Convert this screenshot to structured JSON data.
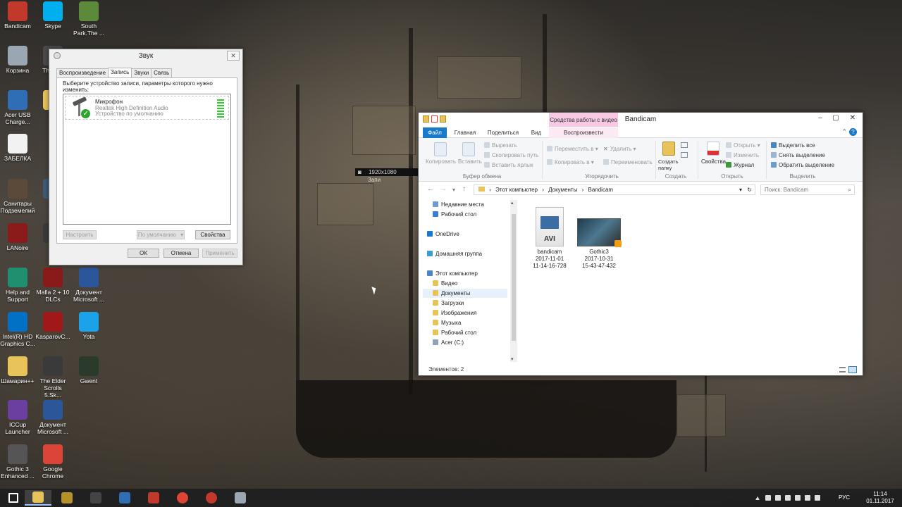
{
  "desktop": {
    "icons": [
      {
        "label": "Bandicam",
        "icon": "bandicam-icon",
        "color": "#c0392b"
      },
      {
        "label": "Skype",
        "icon": "skype-icon",
        "color": "#00aff0"
      },
      {
        "label": "South Park.The ...",
        "icon": "southpark-icon",
        "color": "#5d8a3a"
      },
      {
        "label": "Корзина",
        "icon": "recycle-bin-icon",
        "color": "#9aa7b3"
      },
      {
        "label": "Th Scro",
        "icon": "game-icon",
        "color": "#4a4a4a"
      },
      {
        "label": "Acer USB Charge...",
        "icon": "usb-charge-icon",
        "color": "#2f6db5"
      },
      {
        "label": "DC",
        "icon": "folder-icon",
        "color": "#e8c35a"
      },
      {
        "label": "ЗАБЕЛКА",
        "icon": "document-icon",
        "color": "#f2f2f2"
      },
      {
        "label": "Санитары Подземелий",
        "icon": "game-icon",
        "color": "#5b4a3a"
      },
      {
        "label": "Me",
        "icon": "game-icon",
        "color": "#3e5b78"
      },
      {
        "label": "LANoire",
        "icon": "lanoire-icon",
        "color": "#8b1a1a"
      },
      {
        "label": "S",
        "icon": "game-icon",
        "color": "#3a3a3a"
      },
      {
        "label": "Help and Support",
        "icon": "help-icon",
        "color": "#1f8f6f"
      },
      {
        "label": "Mafia 2 + 10 DLCs",
        "icon": "mafia-icon",
        "color": "#8a1a1a"
      },
      {
        "label": "Документ Microsoft ...",
        "icon": "word-document-icon",
        "color": "#2b579a"
      },
      {
        "label": "Intel(R) HD Graphics C...",
        "icon": "intel-graphics-icon",
        "color": "#0071c5"
      },
      {
        "label": "KasparovC...",
        "icon": "chess-icon",
        "color": "#a01818"
      },
      {
        "label": "Yota",
        "icon": "yota-icon",
        "color": "#1aa3e8"
      },
      {
        "label": "Шамарин++",
        "icon": "document-icon",
        "color": "#e8c35a"
      },
      {
        "label": "The Elder Scrolls 5.Sk...",
        "icon": "skyrim-icon",
        "color": "#3a3a3a"
      },
      {
        "label": "Gwent",
        "icon": "gwent-icon",
        "color": "#2b3b2b"
      },
      {
        "label": "ICCup Launcher",
        "icon": "iccup-icon",
        "color": "#6b3fa0"
      },
      {
        "label": "Документ Microsoft ...",
        "icon": "word-document-icon",
        "color": "#2b579a"
      },
      {
        "label": "Gothic 3 Enhanced ...",
        "icon": "gothic-icon",
        "color": "#555555"
      },
      {
        "label": "Google Chrome",
        "icon": "chrome-icon",
        "color": "#db4437"
      }
    ]
  },
  "sound_dialog": {
    "title": "Звук",
    "tabs": [
      "Воспроизведение",
      "Запись",
      "Звуки",
      "Связь"
    ],
    "active_tab": "Запись",
    "instruction": "Выберите устройство записи, параметры которого нужно изменить:",
    "device": {
      "name": "Микрофон",
      "driver": "Realtek High Definition Audio",
      "status": "Устройство по умолчанию"
    },
    "buttons": {
      "configure": "Настроить",
      "default": "По умолчанию",
      "properties": "Свойства",
      "ok": "ОК",
      "cancel": "Отмена",
      "apply": "Применить"
    }
  },
  "overlay": {
    "resolution": "1920x1080",
    "rec_text": "Запи"
  },
  "explorer": {
    "title": "Bandicam",
    "context_tab": "Средства работы с видео",
    "tabs": [
      "Файл",
      "Главная",
      "Поделиться",
      "Вид",
      "Воспроизвести"
    ],
    "ribbon": {
      "clipboard": {
        "label": "Буфер обмена",
        "copy": "Копировать",
        "paste": "Вставить",
        "cut": "Вырезать",
        "copy_path": "Скопировать путь",
        "paste_shortcut": "Вставить ярлык"
      },
      "organize": {
        "label": "Упорядочить",
        "move_to": "Переместить в",
        "copy_to": "Копировать в",
        "delete": "Удалить",
        "rename": "Переименовать"
      },
      "new": {
        "label": "Создать",
        "new_folder": "Создать папку"
      },
      "open": {
        "label": "Открыть",
        "properties": "Свойства",
        "open": "Открыть",
        "edit": "Изменить",
        "history": "Журнал"
      },
      "select": {
        "label": "Выделить",
        "select_all": "Выделить все",
        "select_none": "Снять выделение",
        "invert": "Обратить выделение"
      }
    },
    "breadcrumb": [
      "Этот компьютер",
      "Документы",
      "Bandicam"
    ],
    "search_placeholder": "Поиск: Bandicam",
    "nav": [
      {
        "label": "Недавние места",
        "icon": "recent-places-icon",
        "indent": 1
      },
      {
        "label": "Рабочий стол",
        "icon": "desktop-icon",
        "indent": 1
      },
      {
        "label": "OneDrive",
        "icon": "onedrive-icon",
        "indent": 0
      },
      {
        "label": "Домашняя группа",
        "icon": "homegroup-icon",
        "indent": 0
      },
      {
        "label": "Этот компьютер",
        "icon": "computer-icon",
        "indent": 0
      },
      {
        "label": "Видео",
        "icon": "folder-icon",
        "indent": 1
      },
      {
        "label": "Документы",
        "icon": "folder-icon",
        "indent": 1,
        "selected": true
      },
      {
        "label": "Загрузки",
        "icon": "folder-icon",
        "indent": 1
      },
      {
        "label": "Изображения",
        "icon": "folder-icon",
        "indent": 1
      },
      {
        "label": "Музыка",
        "icon": "folder-icon",
        "indent": 1
      },
      {
        "label": "Рабочий стол",
        "icon": "folder-icon",
        "indent": 1
      },
      {
        "label": "Acer (C:)",
        "icon": "drive-icon",
        "indent": 1
      }
    ],
    "files": [
      {
        "name": "bandicam",
        "line2": "2017-11-01",
        "line3": "11-14-16-728",
        "type": "avi"
      },
      {
        "name": "Gothic3",
        "line2": "2017-10-31",
        "line3": "15-43-47-432",
        "type": "video"
      }
    ],
    "status": "Элементов: 2"
  },
  "taskbar": {
    "apps": [
      {
        "name": "start-button",
        "icon": "windows-logo-icon"
      },
      {
        "name": "explorer",
        "icon": "file-explorer-icon",
        "active": true
      },
      {
        "name": "app-2",
        "icon": "app-icon"
      },
      {
        "name": "app-3",
        "icon": "speaker-app-icon"
      },
      {
        "name": "app-4",
        "icon": "app-icon"
      },
      {
        "name": "app-5",
        "icon": "power-icon"
      },
      {
        "name": "chrome",
        "icon": "chrome-icon"
      },
      {
        "name": "bandicam",
        "icon": "bandicam-icon"
      },
      {
        "name": "sound",
        "icon": "sound-settings-icon"
      }
    ],
    "language": "РУС",
    "time": "11:14",
    "date": "01.11.2017"
  },
  "colors": {
    "accent": "#1979ca",
    "context_tab": "#f7c9e3",
    "level_meter": "#2ecc2e"
  }
}
